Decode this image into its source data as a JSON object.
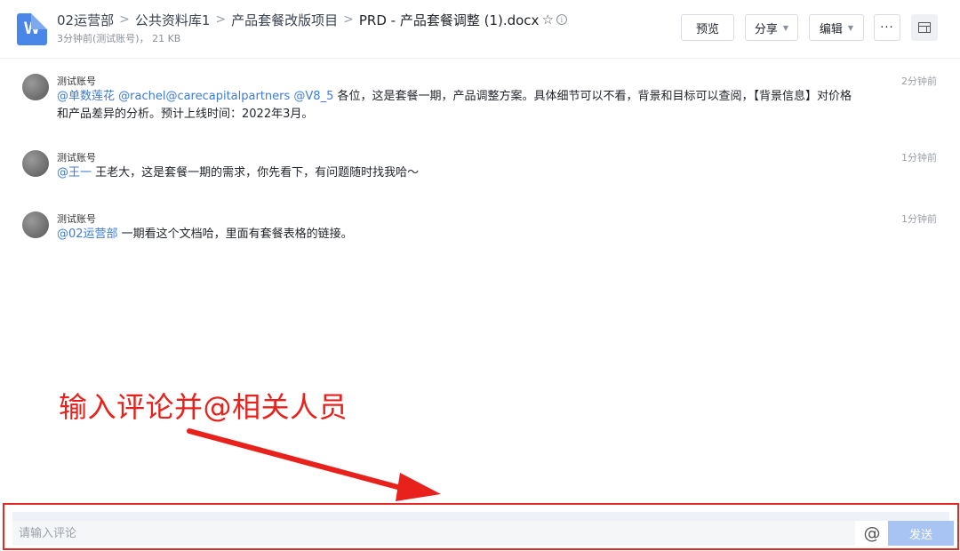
{
  "header": {
    "doc_icon_letter": "W",
    "breadcrumb": [
      "02运营部",
      "公共资料库1",
      "产品套餐改版项目",
      "PRD - 产品套餐调整 (1).docx"
    ],
    "separator": ">",
    "star_icon": "☆",
    "info_icon": "i",
    "meta": "3分钟前(测试账号)， 21 KB",
    "buttons": {
      "preview": "预览",
      "share": "分享",
      "edit": "编辑",
      "more": "···",
      "caret": "▼"
    }
  },
  "comments": [
    {
      "author": "测试账号",
      "time": "2分钟前",
      "mention": "@单数莲花 @rachel@carecapitalpartners @V8_5",
      "text": " 各位，这是套餐一期，产品调整方案。具体细节可以不看，背景和目标可以查阅，【背景信息】对价格和产品差异的分析。预计上线时间：2022年3月。"
    },
    {
      "author": "测试账号",
      "time": "1分钟前",
      "mention": "@王一",
      "text": " 王老大，这是套餐一期的需求，你先看下，有问题随时找我哈～"
    },
    {
      "author": "测试账号",
      "time": "1分钟前",
      "mention": "@02运营部",
      "text": " 一期看这个文档哈，里面有套餐表格的链接。"
    }
  ],
  "annotation": "输入评论并@相关人员",
  "input": {
    "placeholder": "请输入评论",
    "at_symbol": "@",
    "send_label": "发送"
  },
  "colors": {
    "accent": "#3c7bd8",
    "annotation_red": "#e8211c",
    "send_button": "#a8c4f2"
  }
}
